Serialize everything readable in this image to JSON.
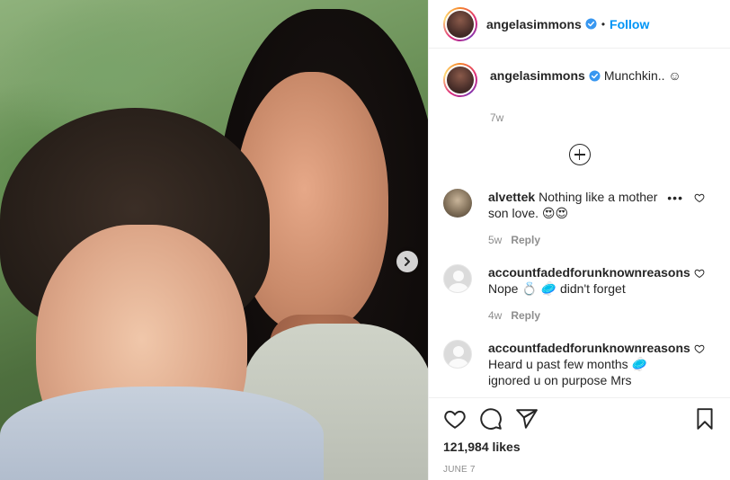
{
  "post": {
    "username": "angelasimmons",
    "dot": "•",
    "follow_label": "Follow"
  },
  "caption": {
    "username": "angelasimmons",
    "text": "Munchkin.. ☺",
    "time": "7w"
  },
  "comments": [
    {
      "username": "alvettek",
      "text": "Nothing like a mother son love. 😍😍",
      "time": "5w",
      "reply_label": "Reply",
      "more": "•••",
      "avatar": "photo"
    },
    {
      "username": "accountfadedforunknownreasons",
      "text": "Nope 💍 🥏 didn't forget",
      "time": "4w",
      "reply_label": "Reply",
      "avatar": "blank"
    },
    {
      "username": "accountfadedforunknownreasons",
      "text": "Heard u past few months 🥏 ignored u on purpose Mrs",
      "avatar": "blank"
    }
  ],
  "footer": {
    "likes": "121,984 likes",
    "date": "JUNE 7"
  },
  "icons": {
    "verified": "verified-badge-icon",
    "load_more": "plus-circle-icon",
    "like": "heart-icon",
    "comment": "comment-bubble-icon",
    "share": "paper-plane-icon",
    "save": "bookmark-icon",
    "next": "chevron-right-icon"
  },
  "colors": {
    "accent": "#0095f6",
    "muted": "#8e8e8e",
    "text": "#262626"
  }
}
